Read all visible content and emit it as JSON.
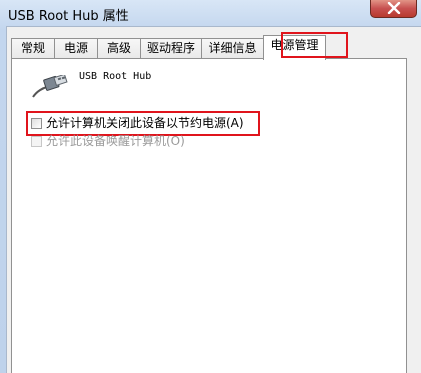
{
  "window": {
    "title": "USB Root Hub 属性"
  },
  "tabs": [
    {
      "label": "常规"
    },
    {
      "label": "电源"
    },
    {
      "label": "高级"
    },
    {
      "label": "驱动程序"
    },
    {
      "label": "详细信息"
    },
    {
      "label": "电源管理",
      "active": true
    }
  ],
  "device": {
    "name": "USB Root Hub",
    "icon": "usb-plug-icon"
  },
  "options": [
    {
      "label": "允许计算机关闭此设备以节约电源(A)",
      "checked": false,
      "enabled": true
    },
    {
      "label": "允许此设备唤醒计算机(O)",
      "checked": false,
      "enabled": false
    }
  ],
  "colors": {
    "highlight": "#e0141c",
    "titlebar": "#c3d6ee",
    "close_button": "#c75050"
  }
}
